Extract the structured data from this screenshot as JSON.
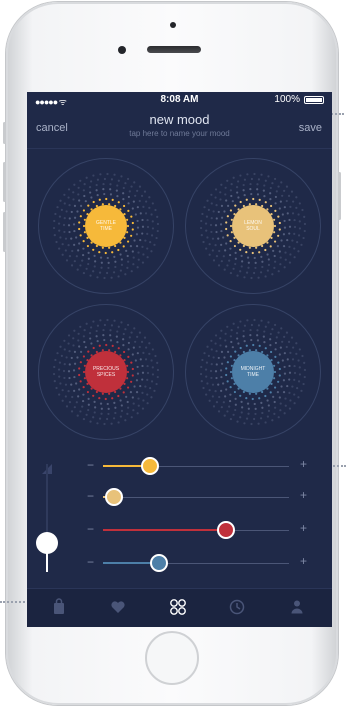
{
  "status_bar": {
    "carrier": "●●●●● ᯤ",
    "time": "8:08 AM",
    "battery": "100%"
  },
  "header": {
    "cancel": "cancel",
    "save": "save",
    "title": "new mood",
    "subtitle": "tap here to name your mood"
  },
  "scents": [
    {
      "label": "GENTLE\nTIME",
      "color": "#f6b93a"
    },
    {
      "label": "LEMON\nSOUL",
      "color": "#e8c27a"
    },
    {
      "label": "PRECIOUS\nSPICES",
      "color": "#c0303b"
    },
    {
      "label": "MIDNIGHT\nTIME",
      "color": "#4d7fa8"
    }
  ],
  "sliders": [
    {
      "minus": "−",
      "plus": "+",
      "value": 0.25,
      "color": "#f6b93a"
    },
    {
      "minus": "−",
      "plus": "+",
      "value": 0.06,
      "color": "#e8c27a"
    },
    {
      "minus": "−",
      "plus": "+",
      "value": 0.66,
      "color": "#c0303b"
    },
    {
      "minus": "−",
      "plus": "+",
      "value": 0.3,
      "color": "#4d7fa8"
    }
  ],
  "master_slider": {
    "value": 0.27
  },
  "tabs": [
    {
      "icon": "bag-icon",
      "active": false
    },
    {
      "icon": "heart-icon",
      "active": false
    },
    {
      "icon": "grid-circles-icon",
      "active": true
    },
    {
      "icon": "clock-icon",
      "active": false
    },
    {
      "icon": "person-icon",
      "active": false
    }
  ]
}
